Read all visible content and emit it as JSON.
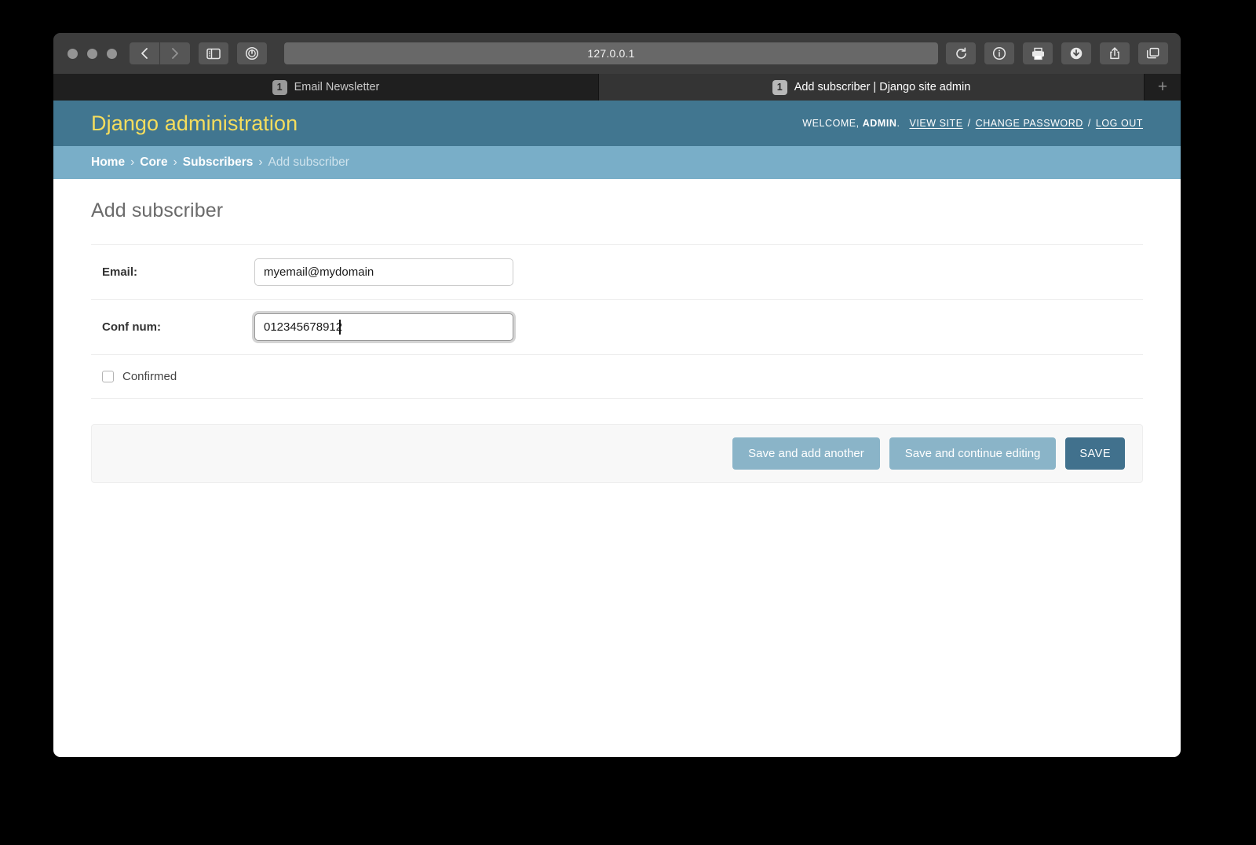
{
  "browser": {
    "url": "127.0.0.1",
    "traffic_lights": [
      "close",
      "minimize",
      "maximize"
    ],
    "nav": {
      "back": "back-arrow",
      "forward": "forward-arrow",
      "sidebar": "sidebar-toggle-icon",
      "shield": "privacy-report-icon"
    },
    "actions": {
      "reload": "reload-icon",
      "info": "info-icon",
      "print": "print-icon",
      "download": "download-icon",
      "share": "share-icon",
      "tab_overview": "tab-overview-icon"
    },
    "tabs": [
      {
        "badge": "1",
        "label": "Email Newsletter",
        "active": false
      },
      {
        "badge": "1",
        "label": "Add subscriber | Django site admin",
        "active": true
      }
    ],
    "new_tab_label": "+"
  },
  "admin": {
    "site_name": "Django administration",
    "user_tools": {
      "welcome_prefix": "Welcome,",
      "username": "ADMIN",
      "period": ".",
      "view_site": "View site",
      "change_password": "Change password",
      "log_out": "Log out",
      "separator": "/"
    },
    "breadcrumbs": {
      "home": "Home",
      "app": "Core",
      "model": "Subscribers",
      "current": "Add subscriber",
      "separator": "›"
    },
    "page_title": "Add subscriber",
    "form": {
      "rows": [
        {
          "label": "Email:",
          "value": "myemail@mydomain",
          "focused": false
        },
        {
          "label": "Conf num:",
          "value": "012345678912",
          "focused": true
        }
      ],
      "checkbox": {
        "label": "Confirmed",
        "checked": false
      }
    },
    "submit_row": {
      "save_and_add_another": "Save and add another",
      "save_and_continue": "Save and continue editing",
      "save": "SAVE"
    },
    "colors": {
      "header_bg": "#417690",
      "breadcrumb_bg": "#79aec8",
      "site_name": "#f5dd5d",
      "button_secondary": "#8ab4c8",
      "button_primary": "#41718d"
    }
  }
}
